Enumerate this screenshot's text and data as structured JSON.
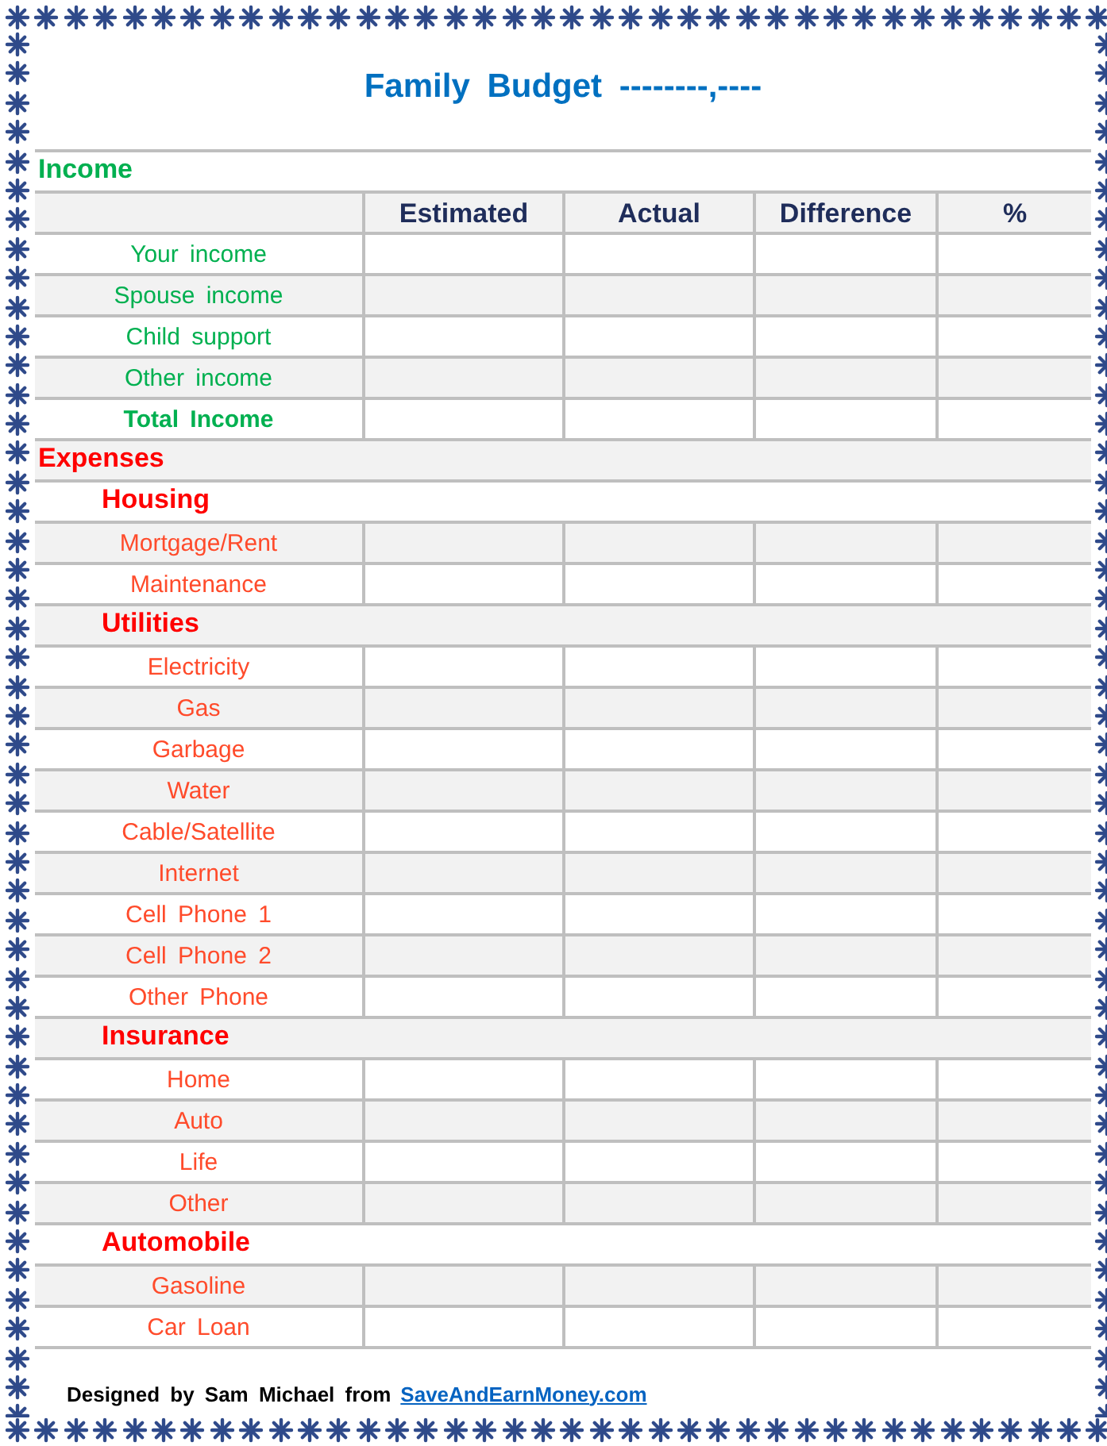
{
  "title": "Family Budget --------,----",
  "rows": [
    {
      "kind": "section",
      "color": "#00b050",
      "label": "Income"
    },
    {
      "kind": "header",
      "columns": [
        "Estimated",
        "Actual",
        "Difference",
        "%"
      ]
    },
    {
      "kind": "item",
      "color": "#00b050",
      "label": "Your income"
    },
    {
      "kind": "item",
      "color": "#00b050",
      "label": "Spouse income"
    },
    {
      "kind": "item",
      "color": "#00b050",
      "label": "Child support"
    },
    {
      "kind": "item",
      "color": "#00b050",
      "label": "Other income"
    },
    {
      "kind": "total",
      "color": "#00b050",
      "label": "Total Income"
    },
    {
      "kind": "section",
      "color": "#ff0000",
      "label": "Expenses"
    },
    {
      "kind": "category",
      "color": "#ff0000",
      "label": "Housing"
    },
    {
      "kind": "item",
      "color": "#ff4b2b",
      "label": "Mortgage/Rent"
    },
    {
      "kind": "item",
      "color": "#ff4b2b",
      "label": "Maintenance"
    },
    {
      "kind": "category",
      "color": "#ff0000",
      "label": "Utilities"
    },
    {
      "kind": "item",
      "color": "#ff4b2b",
      "label": "Electricity"
    },
    {
      "kind": "item",
      "color": "#ff4b2b",
      "label": "Gas"
    },
    {
      "kind": "item",
      "color": "#ff4b2b",
      "label": "Garbage"
    },
    {
      "kind": "item",
      "color": "#ff4b2b",
      "label": "Water"
    },
    {
      "kind": "item",
      "color": "#ff4b2b",
      "label": "Cable/Satellite"
    },
    {
      "kind": "item",
      "color": "#ff4b2b",
      "label": "Internet"
    },
    {
      "kind": "item",
      "color": "#ff4b2b",
      "label": "Cell Phone 1"
    },
    {
      "kind": "item",
      "color": "#ff4b2b",
      "label": "Cell Phone 2"
    },
    {
      "kind": "item",
      "color": "#ff4b2b",
      "label": "Other Phone"
    },
    {
      "kind": "category",
      "color": "#ff0000",
      "label": "Insurance"
    },
    {
      "kind": "item",
      "color": "#ff4b2b",
      "label": "Home"
    },
    {
      "kind": "item",
      "color": "#ff4b2b",
      "label": "Auto"
    },
    {
      "kind": "item",
      "color": "#ff4b2b",
      "label": "Life"
    },
    {
      "kind": "item",
      "color": "#ff4b2b",
      "label": "Other"
    },
    {
      "kind": "category",
      "color": "#ff0000",
      "label": "Automobile"
    },
    {
      "kind": "item",
      "color": "#ff4b2b",
      "label": "Gasoline"
    },
    {
      "kind": "item",
      "color": "#ff4b2b",
      "label": "Car Loan"
    }
  ],
  "footer": {
    "text": "Designed by Sam Michael from",
    "link": "SaveAndEarnMoney.com"
  }
}
